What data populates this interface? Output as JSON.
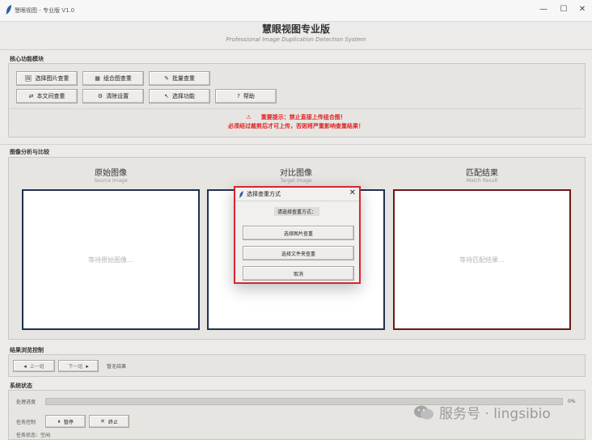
{
  "window": {
    "title": "慧眼视图 - 专业版 V1.0",
    "minimize": "—",
    "maximize": "☐",
    "close": "✕"
  },
  "header": {
    "title": "慧眼视图专业版",
    "subtitle": "Professional Image Duplication Detection System"
  },
  "core": {
    "label": "核心功能模块",
    "buttons": [
      {
        "icon": "🖼",
        "label": "选择图片查重"
      },
      {
        "icon": "▦",
        "label": "组合图查重"
      },
      {
        "icon": "✎",
        "label": "批量查重"
      },
      {
        "icon": "⇄",
        "label": "本文间查重"
      },
      {
        "icon": "⚙",
        "label": "清除设置"
      },
      {
        "icon": "↖",
        "label": "选择功能"
      },
      {
        "icon": "?",
        "label": "帮助"
      }
    ],
    "warning_icon": "⚠",
    "warning_line1": "重要提示：禁止直接上传组合图！",
    "warning_line2": "必须经过裁剪后才可上传，否则将严重影响查重结果！"
  },
  "analysis": {
    "label": "图像分析与比较",
    "columns": [
      {
        "title": "原始图像",
        "subtitle": "Source Image",
        "placeholder": "等待原始图像...",
        "border": "#1f3150"
      },
      {
        "title": "对比图像",
        "subtitle": "Target Image",
        "placeholder": "",
        "border": "#1f3150"
      },
      {
        "title": "匹配结果",
        "subtitle": "Match Result",
        "placeholder": "等待匹配结果...",
        "border": "#6e1818"
      }
    ]
  },
  "dialog": {
    "title": "选择查重方式",
    "close": "✕",
    "prompt": "请选择查重方式：",
    "options": [
      "选择图片查重",
      "选择文件夹查重",
      "取消"
    ],
    "accent": "#d9252c"
  },
  "browse": {
    "label": "结果浏览控制",
    "prev": "上一组",
    "next": "下一组",
    "prev_icon": "◂",
    "next_icon": "▸",
    "status": "暂无结果"
  },
  "status": {
    "label": "系统状态",
    "progress_label": "处理进度",
    "progress_value": 0,
    "progress_text": "0%",
    "task_label": "任务控制",
    "pause": "暂停",
    "stop": "终止",
    "pause_icon": "⏸",
    "stop_icon": "✕",
    "bottom_text": "任务状态：空闲"
  },
  "watermark": "服务号 · lingsibio"
}
